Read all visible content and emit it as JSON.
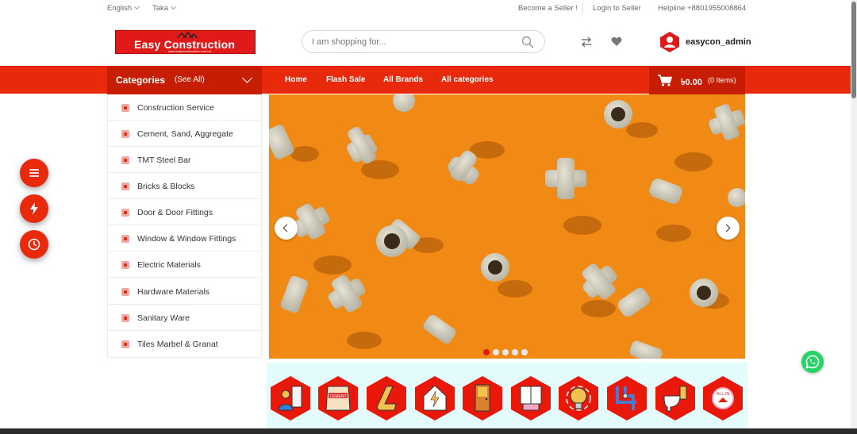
{
  "topbar": {
    "language": "English",
    "currency": "Taka",
    "become_seller": "Become a Seller !",
    "login_seller": "Login to Seller",
    "helpline": "Helpline +8801955008864"
  },
  "brand": {
    "name": "Easy Construction",
    "tagline": "www.easyconstruction.com.bd",
    "color": "#e01919"
  },
  "search": {
    "placeholder": "I am shopping for..."
  },
  "user": {
    "name": "easycon_admin"
  },
  "nav": {
    "categories_label": "Categories",
    "see_all_label": "(See All)",
    "links": [
      "Home",
      "Flash Sale",
      "All Brands",
      "All categories"
    ],
    "cart_amount": "৳0.00",
    "cart_items": "(0 Items)",
    "accent_color": "#e8290b"
  },
  "categories": [
    "Construction Service",
    "Cement, Sand, Aggregate",
    "TMT Steel Bar",
    "Bricks & Blocks",
    "Door & Door Fittings",
    "Window & Window Fittings",
    "Electric Materials",
    "Hardware Materials",
    "Sanitary Ware",
    "Tiles Marbel & Granat"
  ],
  "slider": {
    "slide_count": 5,
    "active_slide": 1
  },
  "icon_strip": {
    "icons": [
      "worker-icon",
      "cement-icon",
      "steel-bar-icon",
      "electric-house-icon",
      "door-icon",
      "window-icon",
      "bulb-icon",
      "plumbing-icon",
      "sanitary-icon",
      "all-in-icon"
    ],
    "last_label": "ALL IN"
  },
  "floating": {
    "buttons": [
      "menu-icon",
      "flash-icon",
      "clock-icon"
    ]
  }
}
